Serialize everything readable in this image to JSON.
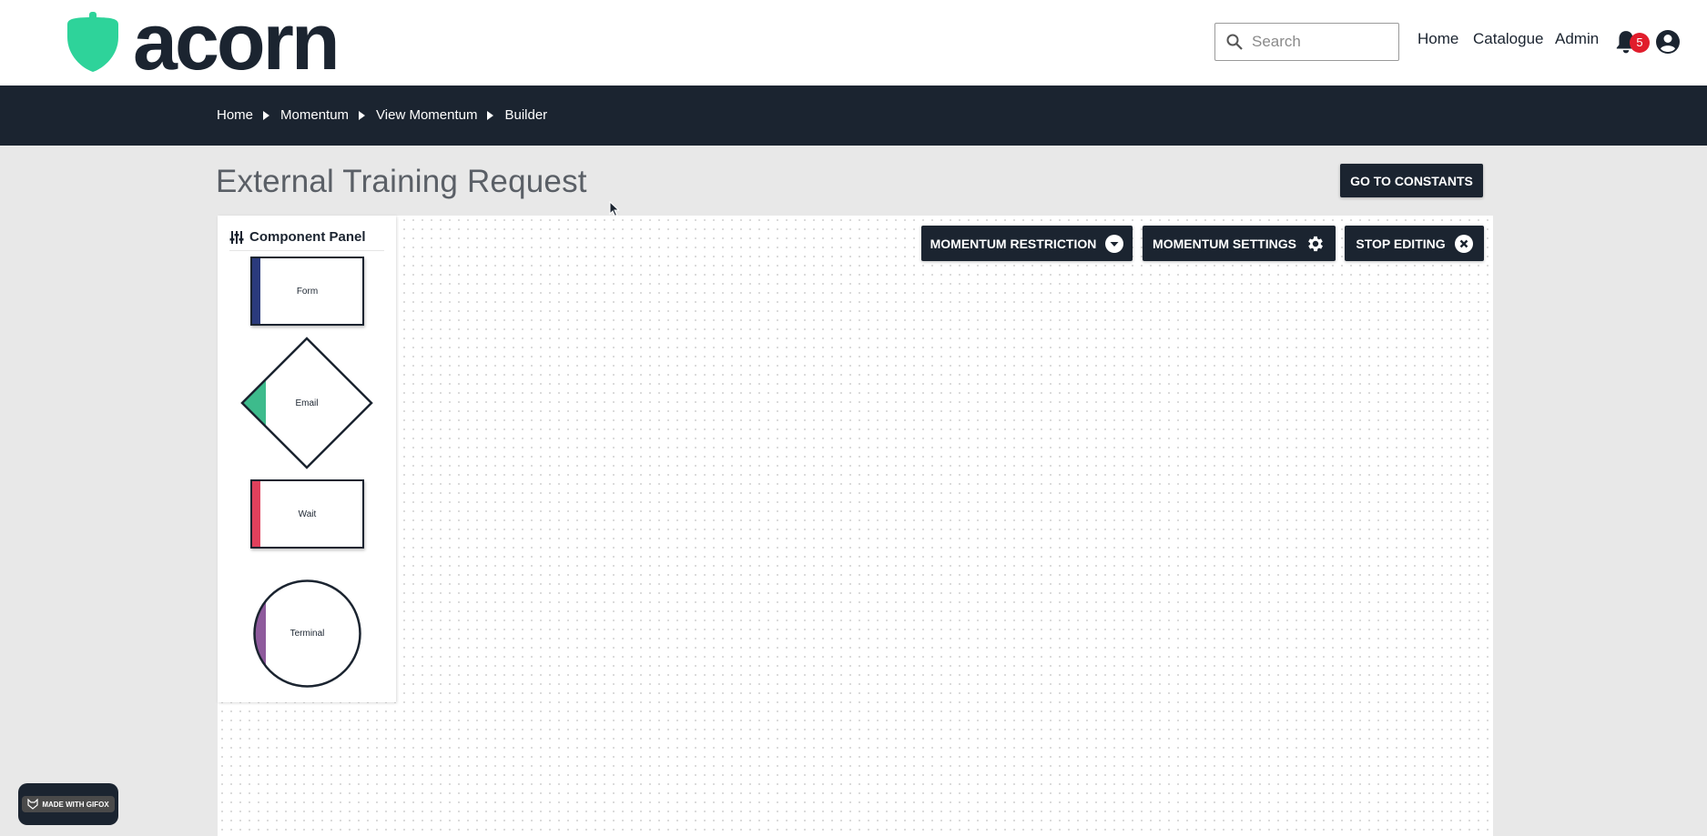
{
  "header": {
    "logo_text": "acorn",
    "search": {
      "placeholder": "Search",
      "value": ""
    },
    "nav": [
      "Home",
      "Catalogue",
      "Admin"
    ],
    "notifications_count": "5",
    "colors": {
      "brand_green": "#2ed39a",
      "dark": "#1b2430",
      "badge_red": "#e11d2c"
    }
  },
  "breadcrumb": [
    "Home",
    "Momentum",
    "View Momentum",
    "Builder"
  ],
  "page": {
    "title": "External Training Request",
    "go_to_constants": "GO TO CONSTANTS"
  },
  "toolbar": {
    "restriction": "MOMENTUM RESTRICTION",
    "settings": "MOMENTUM SETTINGS",
    "stop_editing": "STOP EDITING"
  },
  "component_panel": {
    "title": "Component Panel",
    "components": [
      {
        "label": "Form",
        "color": "#2a3a7c"
      },
      {
        "label": "Email",
        "color": "#3dbb8c"
      },
      {
        "label": "Wait",
        "color": "#e0405c"
      },
      {
        "label": "Terminal",
        "color": "#8e5a9c"
      }
    ]
  },
  "badge": {
    "text": "MADE WITH GIFOX"
  }
}
